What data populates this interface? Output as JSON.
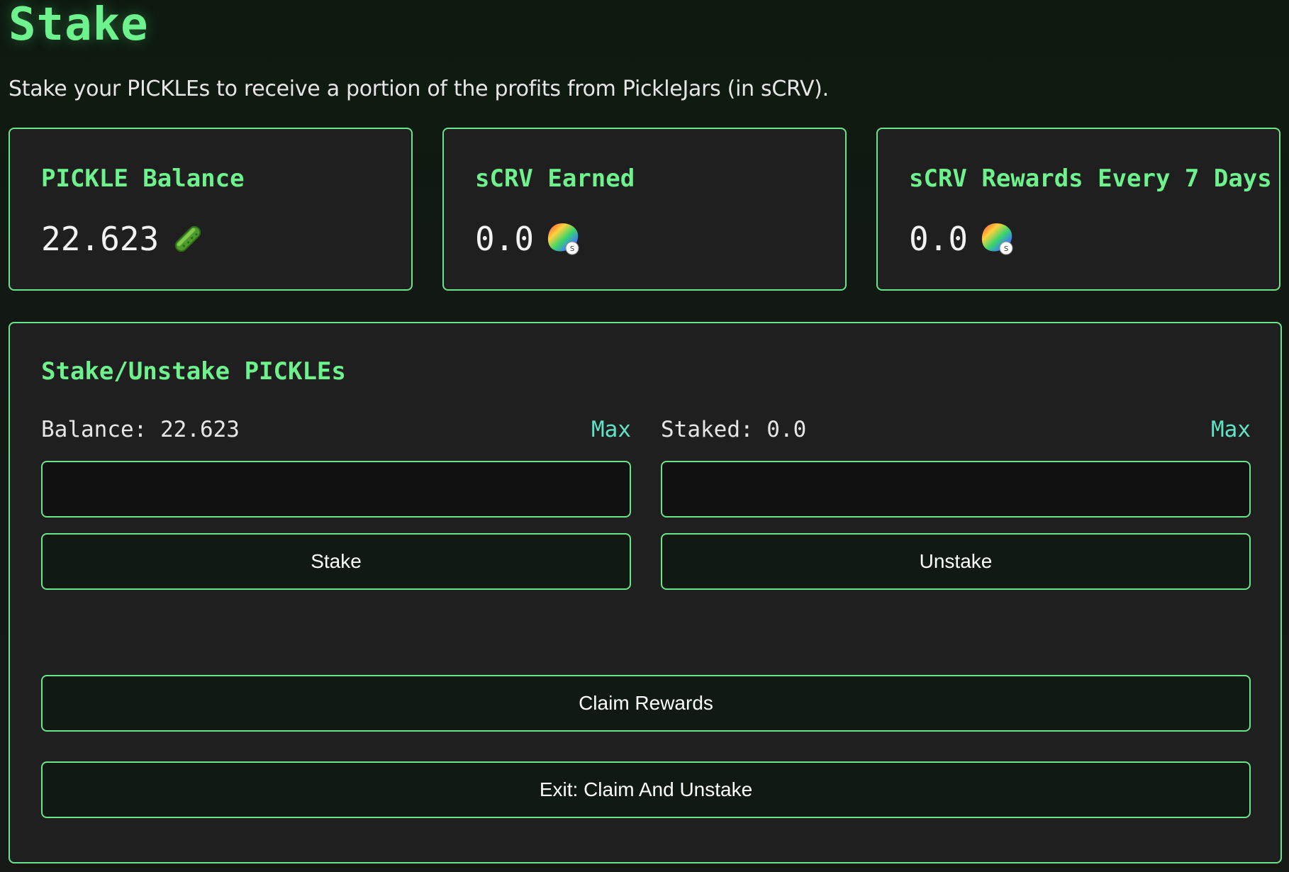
{
  "page": {
    "title": "Stake",
    "subtitle": "Stake your PICKLEs to receive a portion of the profits from PickleJars (in sCRV)."
  },
  "stats": [
    {
      "label": "PICKLE Balance",
      "value": "22.623",
      "icon": "pickle-icon"
    },
    {
      "label": "sCRV Earned",
      "value": "0.0",
      "icon": "scrv-token-icon"
    },
    {
      "label": "sCRV Rewards Every 7 Days",
      "value": "0.0",
      "icon": "scrv-token-icon"
    }
  ],
  "icon_badge": "S",
  "stake_panel": {
    "title": "Stake/Unstake PICKLEs",
    "stake_column": {
      "label": "Balance: 22.623",
      "max_label": "Max",
      "input_value": "",
      "input_placeholder": "",
      "button_label": "Stake"
    },
    "unstake_column": {
      "label": "Staked: 0.0",
      "max_label": "Max",
      "input_value": "",
      "input_placeholder": "",
      "button_label": "Unstake"
    },
    "claim_label": "Claim Rewards",
    "exit_label": "Exit: Claim And Unstake"
  },
  "colors": {
    "accent": "#6df28d",
    "border": "#6be38a",
    "max_link": "#5fe3c6",
    "card_bg": "#1f1f1f",
    "page_bg": "#141814"
  }
}
